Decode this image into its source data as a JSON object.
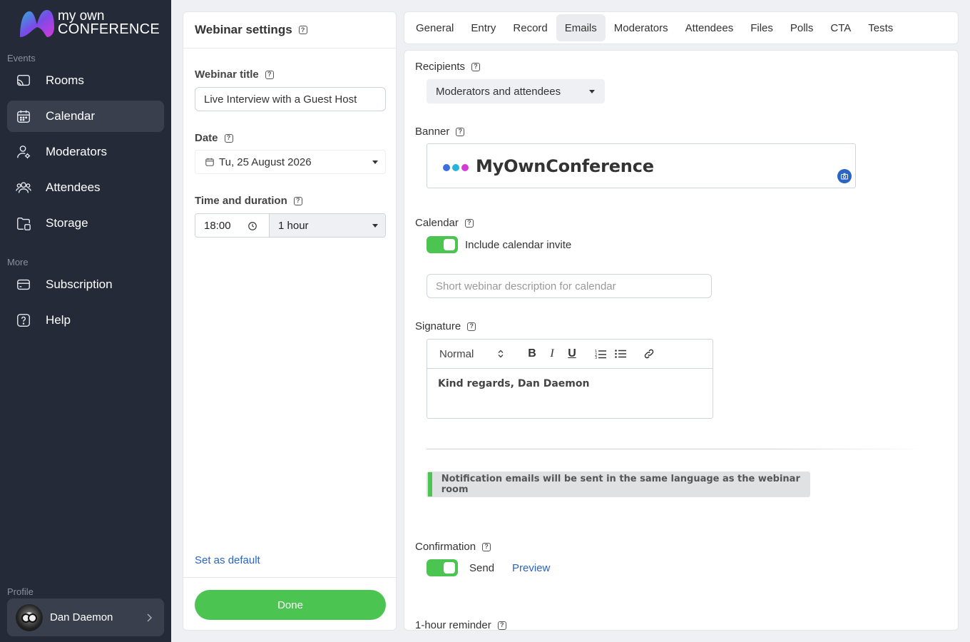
{
  "app": {
    "logo_line1": "my own",
    "logo_line2": "CONFERENCE"
  },
  "sidebar": {
    "events_label": "Events",
    "more_label": "More",
    "profile_label": "Profile",
    "items": [
      {
        "label": "Rooms",
        "icon": "cast-icon"
      },
      {
        "label": "Calendar",
        "icon": "calendar-icon",
        "active": true
      },
      {
        "label": "Moderators",
        "icon": "moderator-icon"
      },
      {
        "label": "Attendees",
        "icon": "attendees-icon"
      },
      {
        "label": "Storage",
        "icon": "storage-icon"
      }
    ],
    "more_items": [
      {
        "label": "Subscription",
        "icon": "card-icon"
      },
      {
        "label": "Help",
        "icon": "help-icon"
      }
    ],
    "profile_name": "Dan Daemon"
  },
  "settings": {
    "title": "Webinar settings",
    "webinar_title_label": "Webinar title",
    "webinar_title_value": "Live Interview with a Guest Host",
    "date_label": "Date",
    "date_value": "Tu, 25 August 2026",
    "time_label": "Time and duration",
    "time_value": "18:00",
    "duration_value": "1 hour",
    "set_default": "Set as default",
    "done": "Done"
  },
  "tabs": [
    "General",
    "Entry",
    "Record",
    "Emails",
    "Moderators",
    "Attendees",
    "Files",
    "Polls",
    "CTA",
    "Tests"
  ],
  "active_tab": "Emails",
  "emails": {
    "recipients_label": "Recipients",
    "recipients_value": "Moderators and attendees",
    "banner_label": "Banner",
    "banner_text": "MyOwnConference",
    "calendar_label": "Calendar",
    "calendar_toggle_label": "Include calendar invite",
    "calendar_enabled": true,
    "calendar_desc_placeholder": "Short webinar description for calendar",
    "signature_label": "Signature",
    "editor_format": "Normal",
    "signature_text": "Kind regards, Dan Daemon",
    "notice": "Notification emails will be sent in the same language as the webinar room",
    "confirmation_label": "Confirmation",
    "confirmation_send": "Send",
    "confirmation_enabled": true,
    "preview": "Preview",
    "reminder_label": "1-hour reminder"
  },
  "colors": {
    "accent_green": "#4cc452",
    "link_blue": "#2a64c5",
    "sidebar_bg": "#252a38",
    "banner_dot1": "#3b6fe0",
    "banner_dot2": "#2ab3d9",
    "banner_dot3": "#d43ad8"
  }
}
